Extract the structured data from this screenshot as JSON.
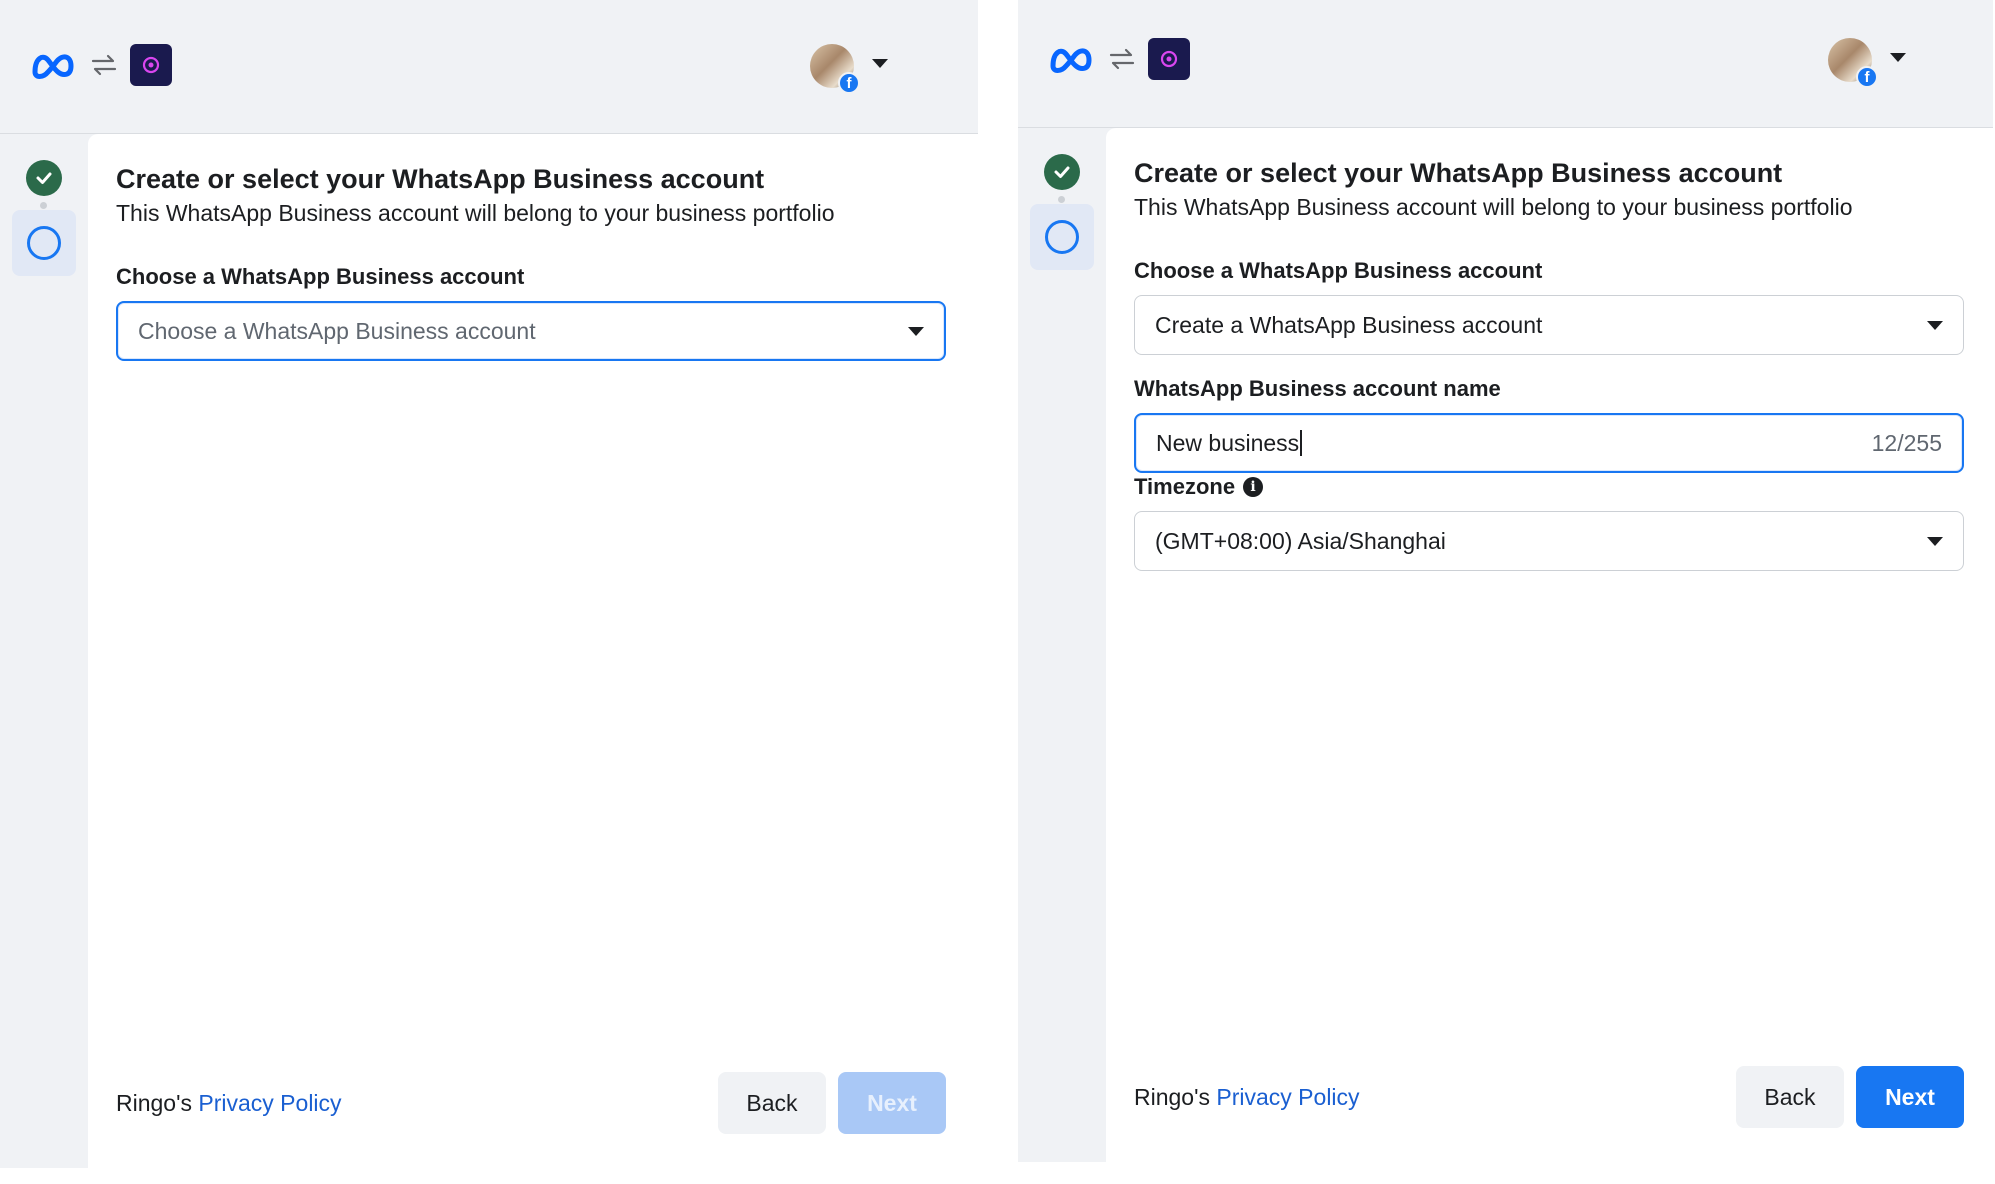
{
  "left": {
    "title": "Create or select your WhatsApp Business account",
    "subtitle": "This WhatsApp Business account will belong to your business portfolio",
    "choose_label": "Choose a WhatsApp Business account",
    "choose_placeholder": "Choose a WhatsApp Business account",
    "footer_owner": "Ringo's",
    "privacy_link": "Privacy Policy",
    "back_label": "Back",
    "next_label": "Next"
  },
  "right": {
    "title": "Create or select your WhatsApp Business account",
    "subtitle": "This WhatsApp Business account will belong to your business portfolio",
    "choose_label": "Choose a WhatsApp Business account",
    "choose_value": "Create a WhatsApp Business account",
    "name_label": "WhatsApp Business account name",
    "name_value": "New business",
    "name_counter": "12/255",
    "timezone_label": "Timezone",
    "timezone_value": "(GMT+08:00) Asia/Shanghai",
    "footer_owner": "Ringo's",
    "privacy_link": "Privacy Policy",
    "back_label": "Back",
    "next_label": "Next"
  },
  "colors": {
    "accent": "#1877f2",
    "step_done": "#2b6a4a",
    "link": "#1a5fd1",
    "next_disabled": "#a9c8f6"
  },
  "icons": [
    "meta-logo-icon",
    "swap-icon",
    "app-icon",
    "facebook-badge-icon",
    "chevron-down-icon",
    "check-icon",
    "info-icon"
  ]
}
